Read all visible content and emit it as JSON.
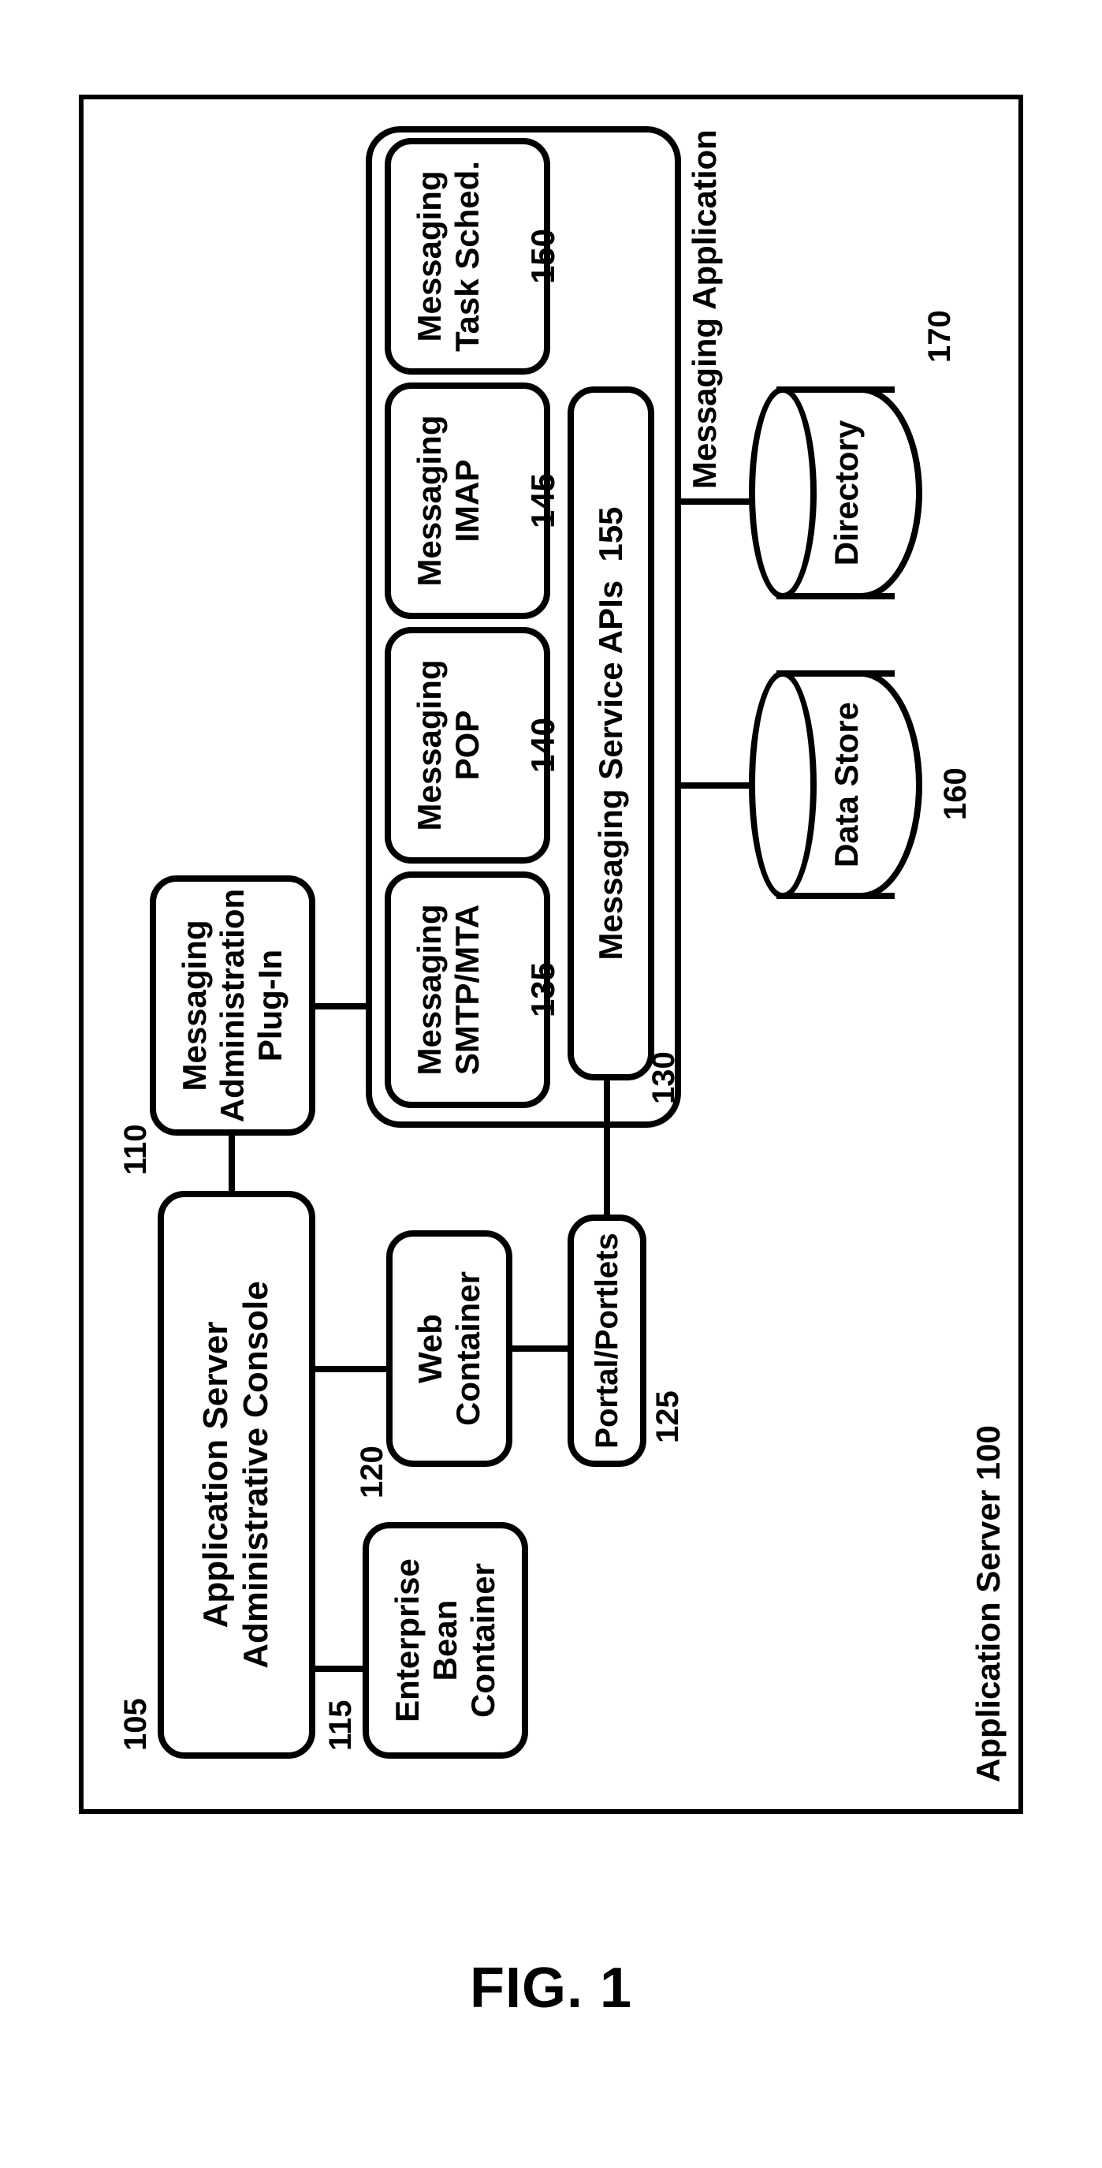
{
  "figure_caption": "FIG. 1",
  "outer": {
    "label": "Application Server",
    "ref": "100"
  },
  "admin_console": {
    "label": "Application Server\nAdministrative Console",
    "ref": "105"
  },
  "msg_admin_plugin": {
    "label": "Messaging\nAdministration\nPlug-In",
    "ref": "110"
  },
  "ejb": {
    "label": "Enterprise\nBean\nContainer",
    "ref": "115"
  },
  "web": {
    "label": "Web\nContainer",
    "ref": "120"
  },
  "portal": {
    "label": "Portal/Portlets",
    "ref": "125"
  },
  "msg_app": {
    "label": "Messaging Application",
    "ref": "130"
  },
  "smtp": {
    "label": "Messaging\nSMTP/MTA",
    "ref": "135"
  },
  "pop": {
    "label": "Messaging\nPOP",
    "ref": "140"
  },
  "imap": {
    "label": "Messaging\nIMAP",
    "ref": "145"
  },
  "sched": {
    "label": "Messaging\nTask Sched.",
    "ref": "150"
  },
  "apis": {
    "label": "Messaging Service APIs",
    "ref": "155"
  },
  "datastore": {
    "label": "Data Store",
    "ref": "160"
  },
  "directory": {
    "label": "Directory",
    "ref": "170"
  }
}
